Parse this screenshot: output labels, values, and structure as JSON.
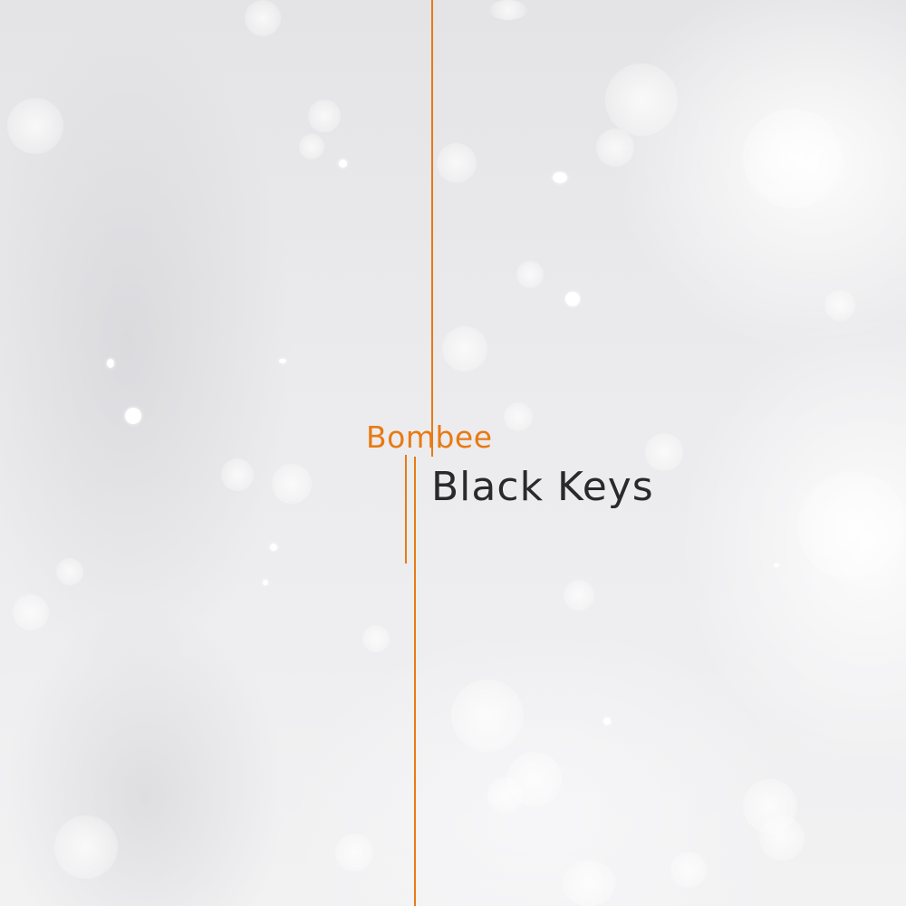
{
  "cover": {
    "artist": "Bombee",
    "album": "Black Keys",
    "accent_color": "#e87a14",
    "text_color": "#2a2a2c",
    "background_color": "#ececee"
  }
}
